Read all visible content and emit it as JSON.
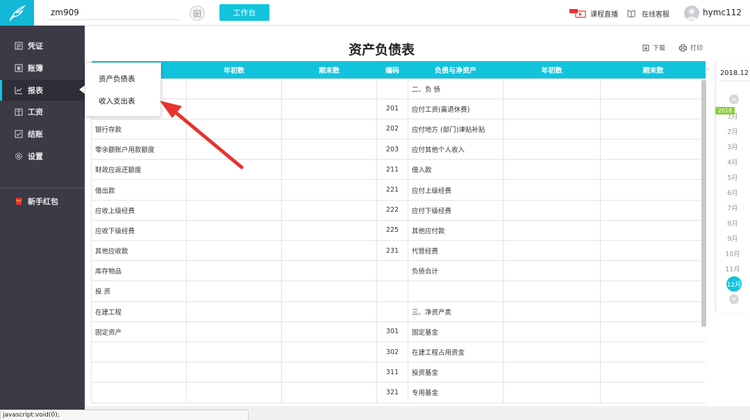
{
  "topbar": {
    "company": "zm909",
    "workbench_label": "工作台",
    "live_label": "课程直播",
    "service_label": "在线客服",
    "username": "hymc112"
  },
  "sidebar": {
    "items": [
      {
        "label": "凭证",
        "icon": "voucher-icon"
      },
      {
        "label": "账簿",
        "icon": "ledger-icon"
      },
      {
        "label": "报表",
        "icon": "chart-icon",
        "active": true
      },
      {
        "label": "工资",
        "icon": "salary-icon"
      },
      {
        "label": "结账",
        "icon": "close-account-icon"
      },
      {
        "label": "设置",
        "icon": "gear-icon"
      }
    ],
    "promo_label": "新手红包"
  },
  "report": {
    "title": "资产负债表",
    "download_label": "下载",
    "print_label": "打印"
  },
  "dropdown": {
    "items": [
      "资产负债表",
      "收入支出表"
    ]
  },
  "table": {
    "headers": [
      "",
      "年初数",
      "期末数",
      "编码",
      "负债与净资产",
      "年初数",
      "期末数"
    ],
    "rows": [
      [
        "",
        "",
        "",
        "",
        "二、负 债",
        "",
        ""
      ],
      [
        "",
        "",
        "",
        "201",
        "应付工资(离退休费)",
        "",
        ""
      ],
      [
        "银行存款",
        "",
        "",
        "202",
        "应付地方 (部门)津贴补贴",
        "",
        ""
      ],
      [
        "零余额账户用款额度",
        "",
        "",
        "203",
        "应付其他个人收入",
        "",
        ""
      ],
      [
        "财政应返还额度",
        "",
        "",
        "211",
        "借入款",
        "",
        ""
      ],
      [
        "借出款",
        "",
        "",
        "221",
        "应付上级经费",
        "",
        ""
      ],
      [
        "应收上级经费",
        "",
        "",
        "222",
        "应付下级经费",
        "",
        ""
      ],
      [
        "应收下级经费",
        "",
        "",
        "225",
        "其他应付款",
        "",
        ""
      ],
      [
        "其他应收款",
        "",
        "",
        "231",
        "代管经费",
        "",
        ""
      ],
      [
        "库存物品",
        "",
        "",
        "",
        "负债合计",
        "",
        ""
      ],
      [
        "投 资",
        "",
        "",
        "",
        "",
        "",
        ""
      ],
      [
        "在建工程",
        "",
        "",
        "",
        "三、净资产类",
        "",
        ""
      ],
      [
        "固定资产",
        "",
        "",
        "301",
        "固定基金",
        "",
        ""
      ],
      [
        "",
        "",
        "",
        "302",
        "在建工程占用资金",
        "",
        ""
      ],
      [
        "",
        "",
        "",
        "311",
        "投资基金",
        "",
        ""
      ],
      [
        "",
        "",
        "",
        "321",
        "专用基金",
        "",
        ""
      ]
    ]
  },
  "period": {
    "selected": "2018.12",
    "year_badge": "2018",
    "months": [
      "1月",
      "2月",
      "3月",
      "4月",
      "5月",
      "6月",
      "7月",
      "8月",
      "9月",
      "10月",
      "11月"
    ],
    "active_month": "12月"
  },
  "statusbar": {
    "text": "javascript:void(0);"
  },
  "colors": {
    "accent": "#12c3dc",
    "sidebar": "#3a3b46",
    "annotation": "#e8322d",
    "badge": "#8dcc3d"
  }
}
